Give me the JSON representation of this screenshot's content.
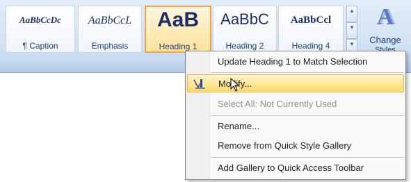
{
  "gallery": {
    "tiles": [
      {
        "sample": "AaBbCcDc",
        "label": "¶ Caption"
      },
      {
        "sample": "AaBbCcL",
        "label": "Emphasis"
      },
      {
        "sample": "AaB",
        "label": "Heading 1"
      },
      {
        "sample": "AaBbC",
        "label": "Heading 2"
      },
      {
        "sample": "AaBbCcl",
        "label": "Heading 4"
      }
    ],
    "selected": "Heading 1"
  },
  "change_styles": {
    "label": "Change",
    "sublabel": "Styles",
    "icon": "change-styles-icon"
  },
  "context_menu": {
    "items": [
      {
        "label": "Update Heading 1 to Match Selection",
        "disabled": false
      },
      {
        "label": "Modify...",
        "disabled": false,
        "highlighted": true,
        "icon": "modify-style-icon"
      },
      {
        "label": "Select All: Not Currently Used",
        "disabled": true
      },
      {
        "label": "Rename...",
        "disabled": false
      },
      {
        "label": "Remove from Quick Style Gallery",
        "disabled": false
      },
      {
        "label": "Add Gallery to Quick Access Toolbar",
        "disabled": false
      }
    ]
  },
  "colors": {
    "accent_highlight": "#ffd96e",
    "selected_border": "#f0a44c",
    "ribbon": "#d6e4f5"
  }
}
